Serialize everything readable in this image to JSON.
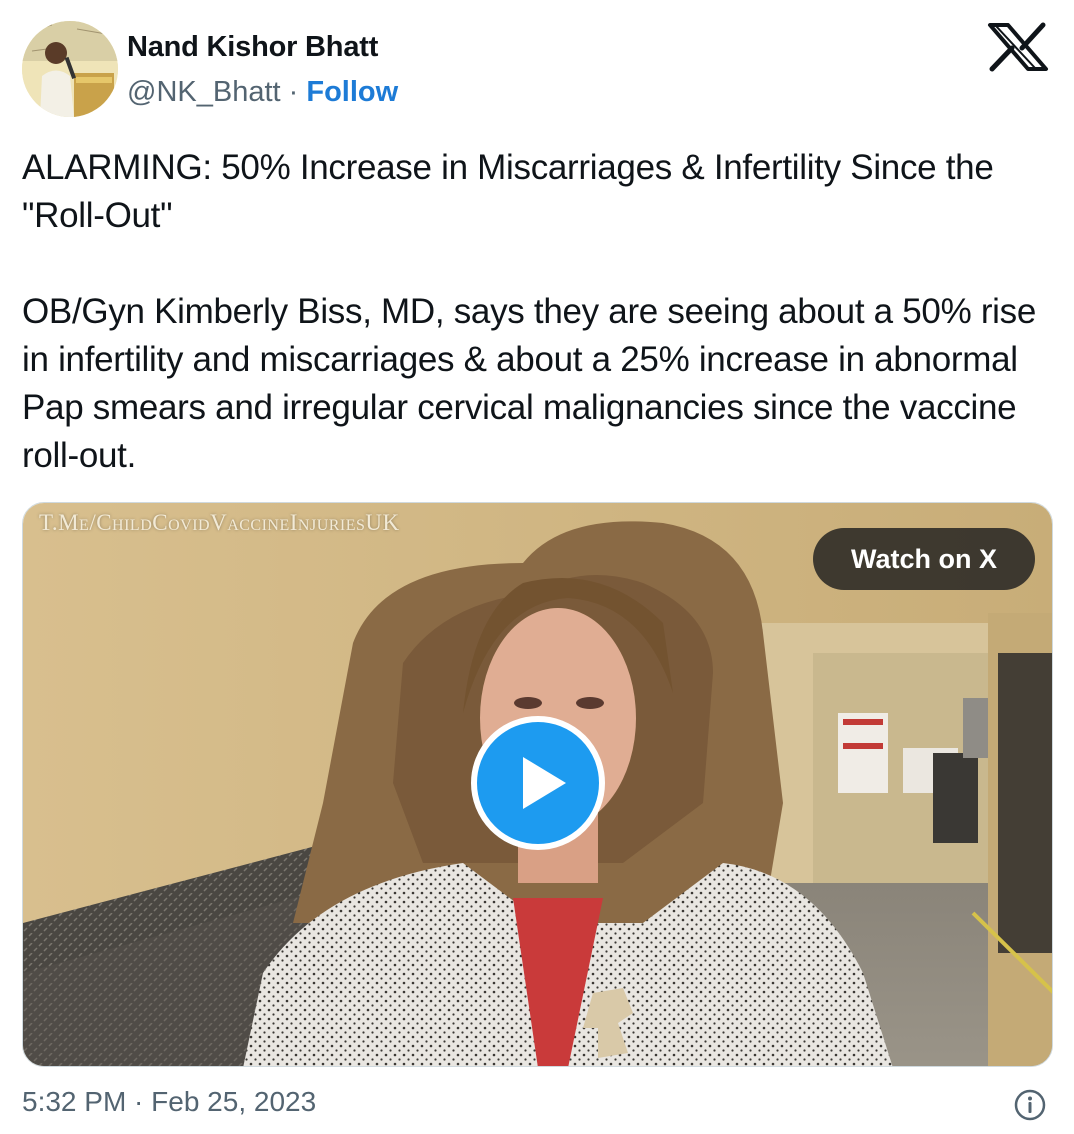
{
  "author": {
    "display_name": "Nand Kishor Bhatt",
    "handle": "@NK_Bhatt",
    "separator": "·",
    "follow_label": "Follow",
    "avatar_icon": "avatar-photo"
  },
  "platform_icon": "x-logo-icon",
  "tweet": {
    "paragraph_1": "ALARMING: 50% Increase in Miscarriages & Infertility Since the \"Roll-Out\"",
    "paragraph_2": "OB/Gyn Kimberly Biss, MD, says they are seeing about a 50% rise in infertility and miscarriages & about a 25% increase in abnormal Pap smears and irregular cervical malignancies since the vaccine roll-out."
  },
  "media": {
    "watermark": "T.Me/ChildCovidVaccineInjuriesUK",
    "watch_label": "Watch on X",
    "play_icon": "play-icon"
  },
  "footer": {
    "timestamp": "5:32 PM · Feb 25, 2023",
    "info_icon": "info-icon"
  },
  "colors": {
    "link": "#1d7bd6",
    "play_button": "#1d9bf0",
    "secondary_text": "#536471",
    "primary_text": "#0f1419"
  }
}
